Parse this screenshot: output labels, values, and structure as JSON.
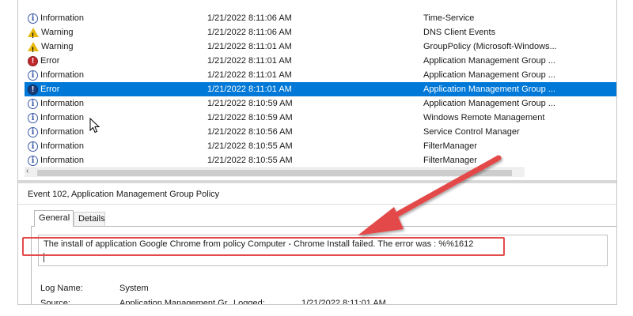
{
  "colors": {
    "selection": "#0078d7",
    "annotation_red": "#e44a4a",
    "warning_yellow": "#e8b810",
    "error_red": "#c0282c",
    "info_blue": "#3b5aa8"
  },
  "events": [
    {
      "level": "Information",
      "icon": "info-icon",
      "datetime": "1/21/2022 8:11:06 AM",
      "source": "Time-Service",
      "selected": false
    },
    {
      "level": "Warning",
      "icon": "warning-icon",
      "datetime": "1/21/2022 8:11:06 AM",
      "source": "DNS Client Events",
      "selected": false
    },
    {
      "level": "Warning",
      "icon": "warning-icon",
      "datetime": "1/21/2022 8:11:01 AM",
      "source": "GroupPolicy (Microsoft-Windows...",
      "selected": false
    },
    {
      "level": "Error",
      "icon": "error-icon",
      "datetime": "1/21/2022 8:11:01 AM",
      "source": "Application Management Group ...",
      "selected": false
    },
    {
      "level": "Information",
      "icon": "info-icon",
      "datetime": "1/21/2022 8:11:01 AM",
      "source": "Application Management Group ...",
      "selected": false
    },
    {
      "level": "Error",
      "icon": "error-icon",
      "datetime": "1/21/2022 8:11:01 AM",
      "source": "Application Management Group ...",
      "selected": true
    },
    {
      "level": "Information",
      "icon": "info-icon",
      "datetime": "1/21/2022 8:10:59 AM",
      "source": "Application Management Group ...",
      "selected": false
    },
    {
      "level": "Information",
      "icon": "info-icon",
      "datetime": "1/21/2022 8:10:59 AM",
      "source": "Windows Remote Management",
      "selected": false
    },
    {
      "level": "Information",
      "icon": "info-icon",
      "datetime": "1/21/2022 8:10:56 AM",
      "source": "Service Control Manager",
      "selected": false
    },
    {
      "level": "Information",
      "icon": "info-icon",
      "datetime": "1/21/2022 8:10:55 AM",
      "source": "FilterManager",
      "selected": false
    },
    {
      "level": "Information",
      "icon": "info-icon",
      "datetime": "1/21/2022 8:10:55 AM",
      "source": "FilterManager",
      "selected": false
    }
  ],
  "detail": {
    "title": "Event 102, Application Management Group Policy",
    "tabs": {
      "general": "General",
      "details": "Details"
    },
    "message": "The install of application Google Chrome from policy Computer - Chrome Install failed.  The error was : %%1612",
    "log_name_label": "Log Name:",
    "log_name_value": "System",
    "source_label": "Source:",
    "source_value": "Application Management Gr...",
    "logged_label": "Logged:",
    "logged_value": "1/21/2022 8:11:01 AM"
  }
}
